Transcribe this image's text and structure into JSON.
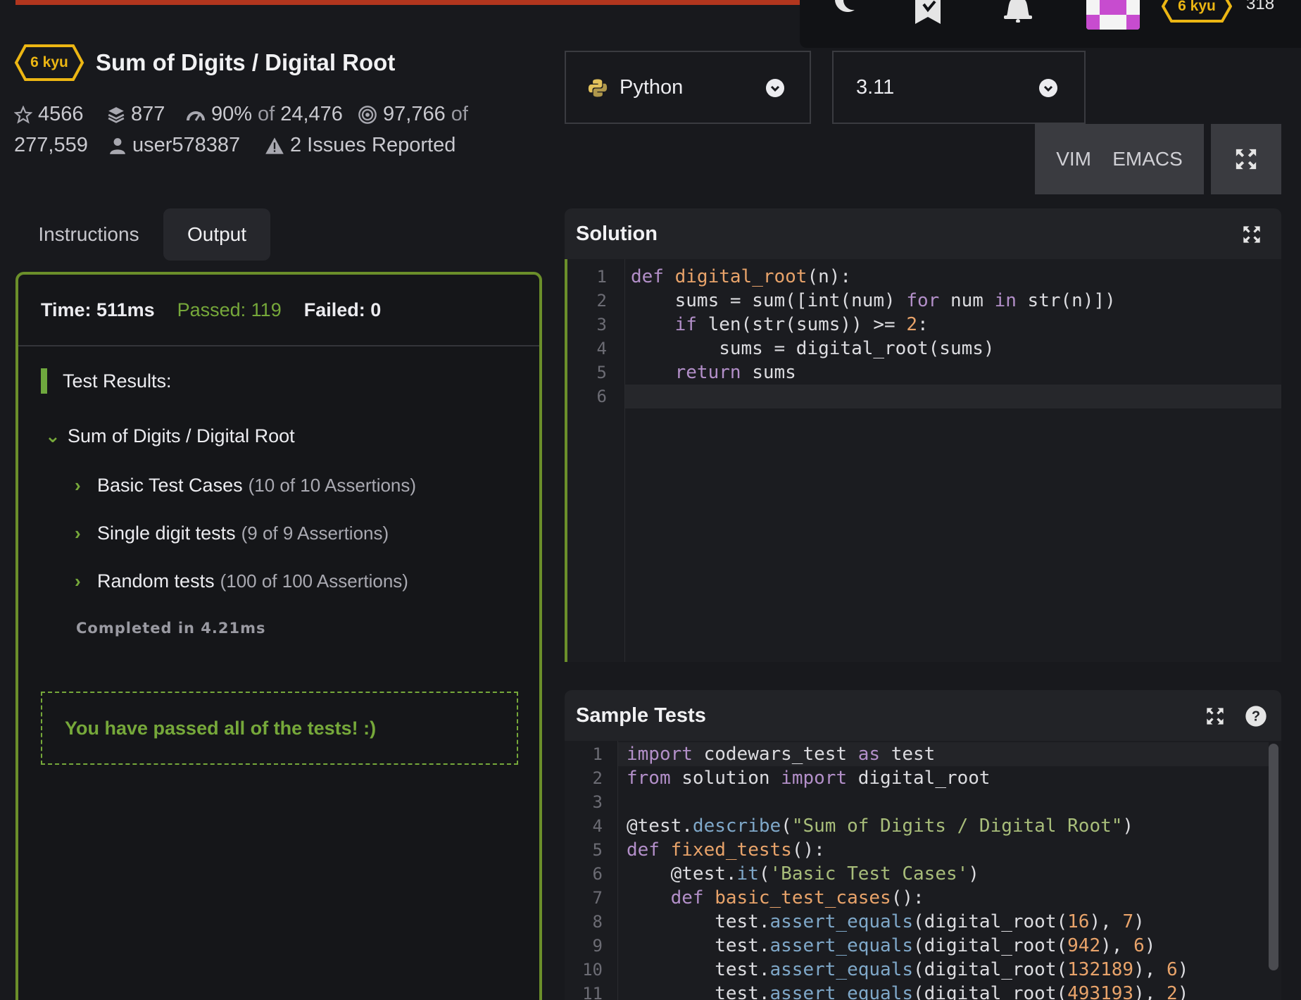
{
  "nav": {
    "rank": "6 kyu",
    "score": "318",
    "icons": [
      "moon-icon",
      "bookmark-icon",
      "bell-icon",
      "avatar",
      "rank-badge"
    ]
  },
  "kata": {
    "rank": "6 kyu",
    "title": "Sum of Digits / Digital Root",
    "stars": "4566",
    "collections": "877",
    "satisfaction_pct": "90%",
    "satisfaction_of": "of",
    "satisfaction_votes": "24,476",
    "completed": "97,766",
    "completed_of": "of",
    "attempts": "277,559",
    "author": "user578387",
    "issues": "2 Issues Reported"
  },
  "tabs": [
    {
      "label": "Instructions",
      "active": false
    },
    {
      "label": "Output",
      "active": true
    }
  ],
  "output": {
    "time": "Time: 511ms",
    "passed": "Passed: 119",
    "failed": "Failed: 0",
    "results_heading": "Test Results:",
    "describe": "Sum of Digits / Digital Root",
    "groups": [
      {
        "name": "Basic Test Cases",
        "count": "(10 of 10 Assertions)"
      },
      {
        "name": "Single digit tests",
        "count": "(9 of 9 Assertions)"
      },
      {
        "name": "Random tests",
        "count": "(100 of 100 Assertions)"
      }
    ],
    "completed_in": "Completed in 4.21ms",
    "success_message": "You have passed all of the tests! :)"
  },
  "editor": {
    "language": "Python",
    "version": "3.11",
    "modes": [
      "VIM",
      "EMACS"
    ]
  },
  "solution": {
    "title": "Solution",
    "line_numbers": [
      "1",
      "2",
      "3",
      "4",
      "5",
      "6"
    ]
  },
  "sample_tests": {
    "title": "Sample Tests",
    "line_numbers": [
      "1",
      "2",
      "3",
      "4",
      "5",
      "6",
      "7",
      "8",
      "9",
      "10",
      "11"
    ]
  },
  "colors": {
    "accent_bar": "#b1361e",
    "rank": "#ecb613",
    "pass": "#76a83a",
    "panel_border": "#6b8f2a"
  }
}
